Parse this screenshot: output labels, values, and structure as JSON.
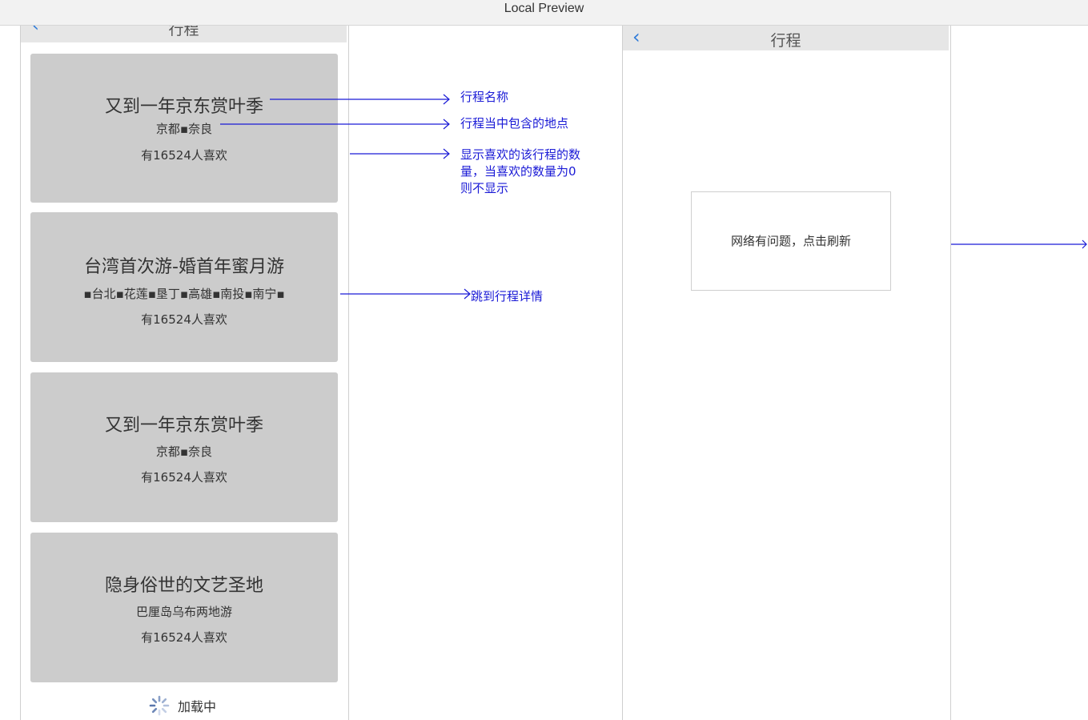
{
  "window": {
    "title": "Local Preview"
  },
  "left_screen": {
    "nav": {
      "back_icon": "chevron-left-icon",
      "title": "行程"
    },
    "trips": [
      {
        "name": "又到一年京东赏叶季",
        "places": "京都▪奈良",
        "likes": "有16524人喜欢"
      },
      {
        "name": "台湾首次游-婚首年蜜月游",
        "places": "▪台北▪花莲▪垦丁▪高雄▪南投▪南宁▪",
        "likes": "有16524人喜欢"
      },
      {
        "name": "又到一年京东赏叶季",
        "places": "京都▪奈良",
        "likes": "有16524人喜欢"
      },
      {
        "name": "隐身俗世的文艺圣地",
        "places": "巴厘岛乌布两地游",
        "likes": "有16524人喜欢"
      }
    ],
    "loading": {
      "icon": "spinner-icon",
      "label": "加载中"
    }
  },
  "annotations": {
    "trip_name": "行程名称",
    "trip_places": "行程当中包含的地点",
    "likes_line1": "显示喜欢的该行程的数",
    "likes_line2": "量，当喜欢的数量为0",
    "likes_line3": "则不显示",
    "jump_detail": "跳到行程详情",
    "arrow_color": "#1a1ad6"
  },
  "right_screen": {
    "nav": {
      "back_icon": "chevron-left-icon",
      "title": "行程"
    },
    "error_message": "网络有问题，点击刷新"
  }
}
